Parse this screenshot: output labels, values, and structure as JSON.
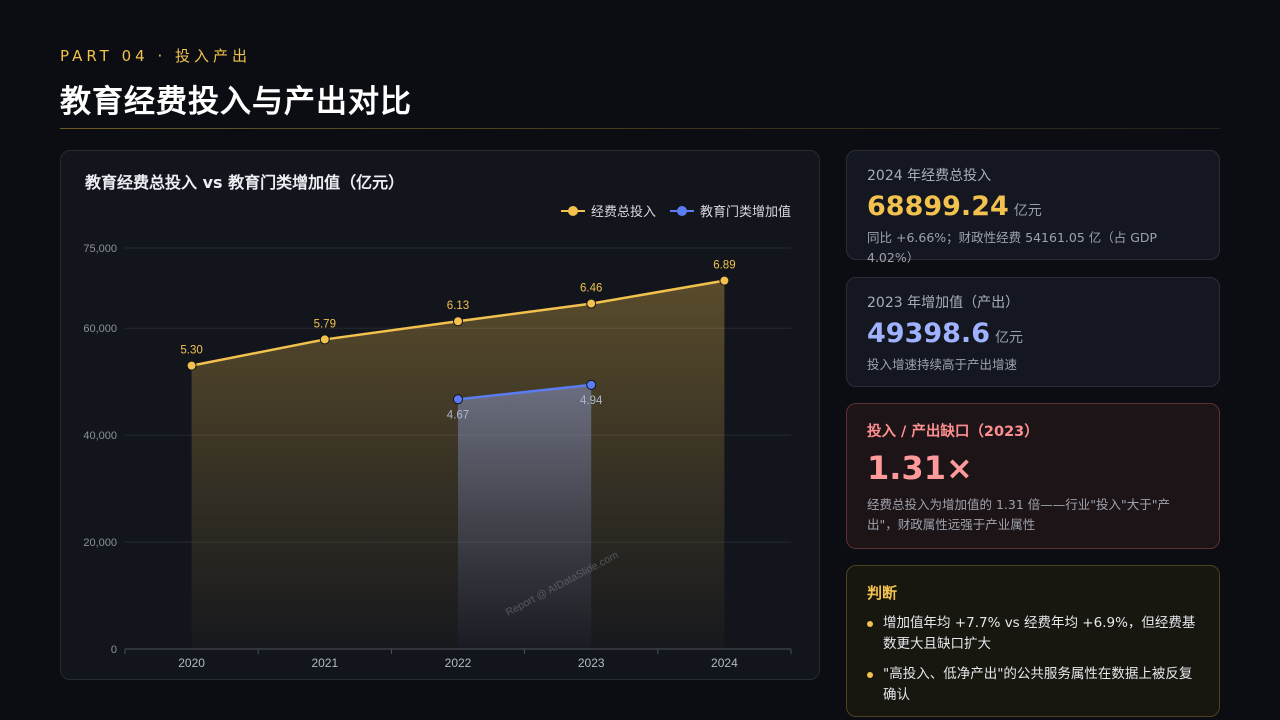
{
  "header": {
    "eyebrow": "PART 04 · 投入产出",
    "title": "教育经费投入与产出对比"
  },
  "colors": {
    "accent": "#f2c14e",
    "series_input": "#f2c14e",
    "series_output": "#5b7cf5",
    "gap": "#ff9a9a",
    "output_value": "#9fb2ff"
  },
  "chart_data": {
    "type": "line",
    "title": "教育经费总投入 vs 教育门类增加值（亿元）",
    "categories": [
      "2020",
      "2021",
      "2022",
      "2023",
      "2024"
    ],
    "ylim": [
      0,
      75000
    ],
    "yticks": [
      0,
      20000,
      40000,
      60000,
      75000
    ],
    "ytick_labels": [
      "0",
      "20,000",
      "40,000",
      "60,000",
      "75,000"
    ],
    "grid": true,
    "legend_position": "top-right",
    "series": [
      {
        "name": "经费总投入",
        "values": [
          53000,
          57900,
          61300,
          64600,
          68900
        ],
        "labels": [
          "5.30",
          "5.79",
          "6.13",
          "6.46",
          "6.89"
        ]
      },
      {
        "name": "教育门类增加值",
        "values": [
          null,
          null,
          46700,
          49400,
          null
        ],
        "labels": [
          "",
          "",
          "4.67",
          "4.94",
          ""
        ]
      }
    ],
    "watermark": "Report @ AIDataSlide.com"
  },
  "cards": {
    "total": {
      "label": "2024 年经费总投入",
      "value": "68899.24",
      "unit": "亿元",
      "note": "同比 +6.66%；财政性经费 54161.05 亿（占 GDP 4.02%）"
    },
    "output": {
      "label": "2023 年增加值（产出）",
      "value": "49398.6",
      "unit": "亿元",
      "note": "投入增速持续高于产出增速"
    },
    "gap": {
      "label": "投入 / 产出缺口（2023）",
      "value": "1.31×",
      "note": "经费总投入为增加值的 1.31 倍——行业\"投入\"大于\"产出\"，财政属性远强于产业属性"
    },
    "judgement": {
      "title": "判断",
      "items": [
        "增加值年均 +7.7% vs 经费年均 +6.9%，但经费基数更大且缺口扩大",
        "\"高投入、低净产出\"的公共服务属性在数据上被反复确认"
      ]
    }
  }
}
